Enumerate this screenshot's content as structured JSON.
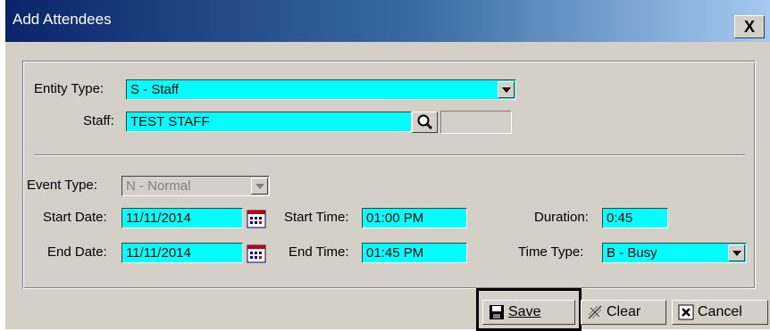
{
  "window": {
    "title": "Add Attendees",
    "close_label": "X"
  },
  "entity_type": {
    "label": "Entity Type:",
    "value": "S - Staff"
  },
  "staff": {
    "label": "Staff:",
    "value": "TEST STAFF"
  },
  "event_type": {
    "label": "Event Type:",
    "value": "N - Normal"
  },
  "start_date": {
    "label": "Start Date:",
    "value": "11/11/2014"
  },
  "end_date": {
    "label": "End Date:",
    "value": "11/11/2014"
  },
  "start_time": {
    "label": "Start Time:",
    "value": "01:00 PM"
  },
  "end_time": {
    "label": "End Time:",
    "value": "01:45 PM"
  },
  "duration": {
    "label": "Duration:",
    "value": "0:45"
  },
  "time_type": {
    "label": "Time Type:",
    "value": "B - Busy"
  },
  "buttons": {
    "save": "Save",
    "clear": "Clear",
    "cancel": "Cancel"
  },
  "colors": {
    "field_bg": "#00ffff",
    "dialog_bg": "#d4d0c8",
    "title_start": "#0a246a",
    "title_end": "#a6caf0"
  },
  "icons": [
    "search-icon",
    "calendar-icon",
    "floppy-disk-icon",
    "eraser-icon",
    "cancel-icon",
    "chevron-down-icon"
  ]
}
